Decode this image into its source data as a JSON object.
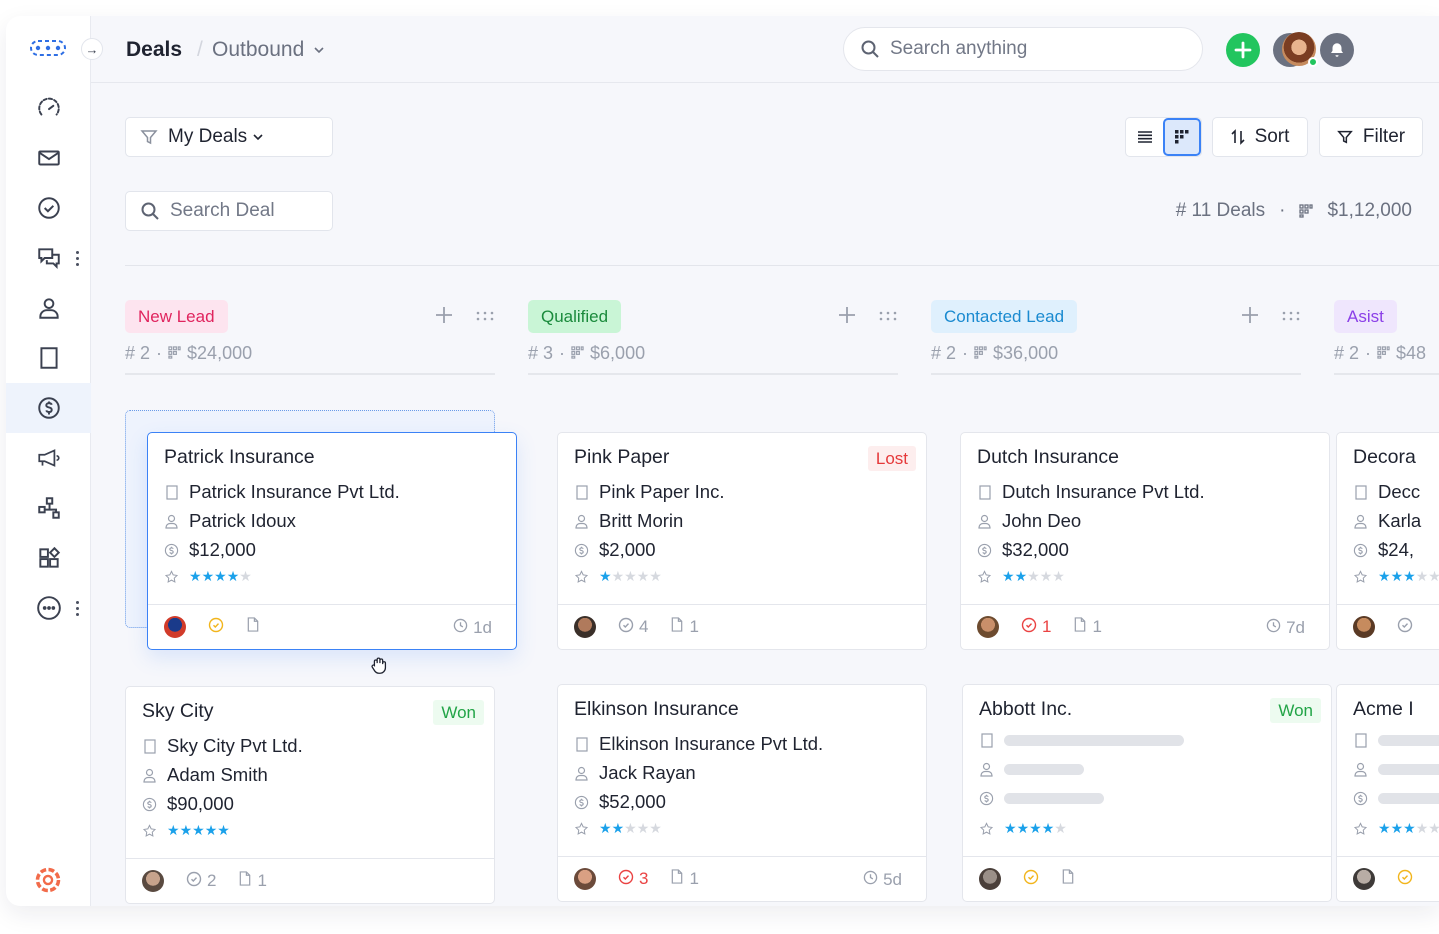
{
  "header": {
    "title": "Deals",
    "separator": "/",
    "pipeline": "Outbound",
    "search_placeholder": "Search anything"
  },
  "toolbar": {
    "view_filter": "My Deals",
    "search_deal_placeholder": "Search Deal",
    "sort_label": "Sort",
    "filter_label": "Filter",
    "deal_count": "# 11 Deals",
    "summary_separator": "·",
    "total_value": "$1,12,000",
    "active_view": "kanban"
  },
  "sidebar": {
    "items": [
      {
        "name": "dashboard",
        "icon": "speedometer-icon"
      },
      {
        "name": "mail",
        "icon": "mail-icon"
      },
      {
        "name": "tasks",
        "icon": "check-circle-icon"
      },
      {
        "name": "conversations",
        "icon": "chat-icon"
      },
      {
        "name": "contacts",
        "icon": "person-icon"
      },
      {
        "name": "accounts",
        "icon": "building-icon"
      },
      {
        "name": "deals",
        "icon": "dollar-circle-icon",
        "active": true
      },
      {
        "name": "campaigns",
        "icon": "megaphone-icon"
      },
      {
        "name": "workflows",
        "icon": "hierarchy-icon"
      },
      {
        "name": "apps",
        "icon": "apps-icon"
      },
      {
        "name": "more",
        "icon": "more-circle-icon"
      }
    ],
    "accent": "#3b82f6"
  },
  "columns": [
    {
      "stage": "New Lead",
      "count": "# 2",
      "dot": "·",
      "value": "$24,000",
      "tag_bg": "#fde4ef",
      "tag_color": "#e0245e",
      "cards": [
        {
          "title": "Patrick Insurance",
          "company": "Patrick Insurance Pvt Ltd.",
          "contact": "Patrick Idoux",
          "amount": "$12,000",
          "rating": 4,
          "status": "",
          "tasks": "",
          "task_state": "pending",
          "files": "",
          "age": "1d",
          "dragging": true
        },
        {
          "title": "Sky City",
          "company": "Sky City Pvt Ltd.",
          "contact": "Adam Smith",
          "amount": "$90,000",
          "rating": 5,
          "status": "Won",
          "tasks": "2",
          "task_state": "normal",
          "files": "1",
          "age": ""
        }
      ]
    },
    {
      "stage": "Qualified",
      "count": "# 3",
      "dot": "·",
      "value": "$6,000",
      "tag_bg": "#c9f5d6",
      "tag_color": "#1a8a3c",
      "cards": [
        {
          "title": "Pink Paper",
          "company": "Pink Paper Inc.",
          "contact": "Britt Morin",
          "amount": "$2,000",
          "rating": 1,
          "status": "Lost",
          "tasks": "4",
          "task_state": "normal",
          "files": "1",
          "age": ""
        },
        {
          "title": "Elkinson Insurance",
          "company": "Elkinson Insurance Pvt Ltd.",
          "contact": "Jack Rayan",
          "amount": "$52,000",
          "rating": 2,
          "status": "",
          "tasks": "3",
          "task_state": "overdue",
          "files": "1",
          "age": "5d"
        }
      ]
    },
    {
      "stage": "Contacted Lead",
      "count": "# 2",
      "dot": "·",
      "value": "$36,000",
      "tag_bg": "#dff0fd",
      "tag_color": "#1a8ad0",
      "cards": [
        {
          "title": "Dutch Insurance",
          "company": "Dutch Insurance Pvt Ltd.",
          "contact": "John Deo",
          "amount": "$32,000",
          "rating": 2,
          "status": "",
          "tasks": "1",
          "task_state": "overdue",
          "files": "1",
          "age": "7d"
        },
        {
          "title": "Abbott Inc.",
          "company": "",
          "contact": "",
          "amount": "",
          "rating": 4,
          "status": "Won",
          "tasks": "",
          "task_state": "pending",
          "files": "",
          "age": "",
          "loading": true
        }
      ]
    },
    {
      "stage": "Asist",
      "count": "# 2",
      "dot": "·",
      "value": "$48",
      "tag_bg": "#efe6fd",
      "tag_color": "#8b3fe8",
      "cards": [
        {
          "title": "Decora",
          "company": "Decc",
          "contact": "Karla",
          "amount": "$24,",
          "rating": 3,
          "status": "",
          "tasks": "",
          "task_state": "normal",
          "files": "",
          "age": ""
        },
        {
          "title": "Acme I",
          "company": "",
          "contact": "",
          "amount": "",
          "rating": 3,
          "status": "",
          "tasks": "",
          "task_state": "pending",
          "files": "",
          "age": "",
          "loading": true
        }
      ]
    }
  ]
}
